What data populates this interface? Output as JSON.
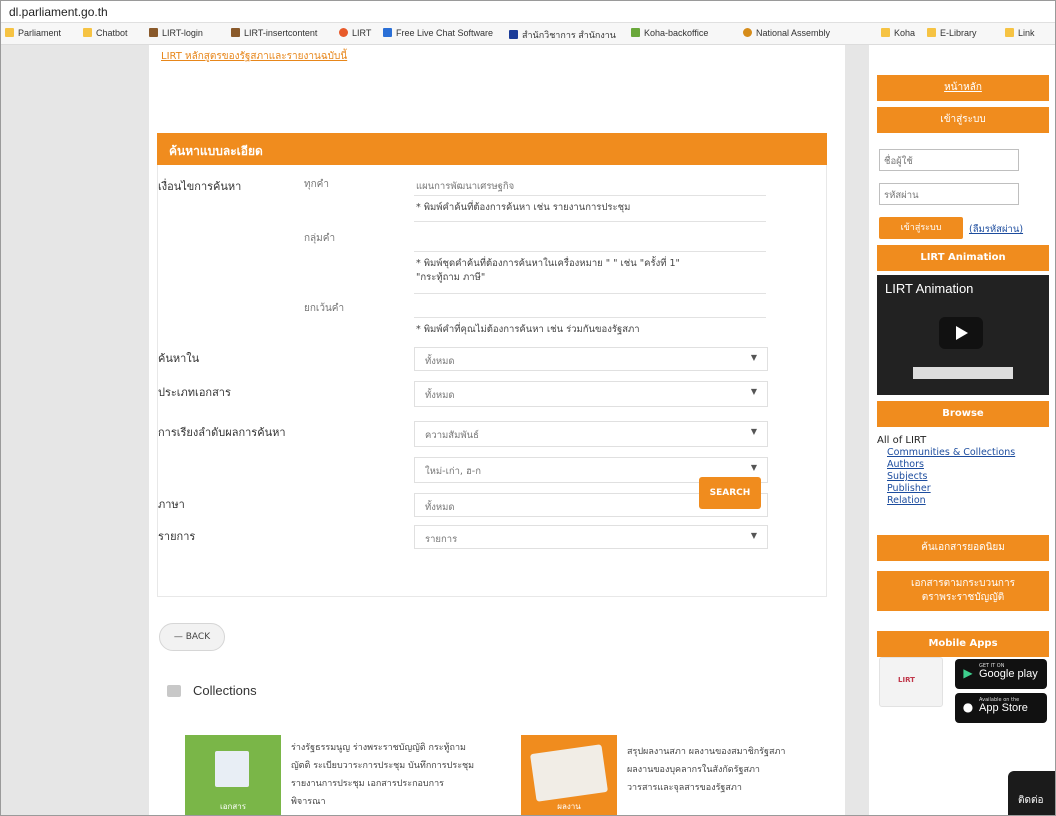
{
  "browser": {
    "address": "dl.parliament.go.th",
    "bookmarks": [
      {
        "label": "Parliament",
        "color": "#f6c343"
      },
      {
        "label": "Chatbot",
        "color": "#f6c343"
      },
      {
        "label": "LIRT-login",
        "color": "#8a5a2b"
      },
      {
        "label": "LIRT-insertcontent",
        "color": "#8a5a2b"
      },
      {
        "label": "LIRT",
        "color": "#e85a2a"
      },
      {
        "label": "Free Live Chat Software",
        "color": "#2a6fd6"
      },
      {
        "label": "สำนักวิชาการ สำนักงาน",
        "color": "#1c3c99"
      },
      {
        "label": "Koha-backoffice",
        "color": "#6aa83b"
      },
      {
        "label": "National Assembly",
        "color": "#d68c1a"
      },
      {
        "label": "Koha",
        "color": "#f6c343"
      },
      {
        "label": "E-Library",
        "color": "#f6c343"
      },
      {
        "label": "Link",
        "color": "#f6c343"
      }
    ]
  },
  "main": {
    "top_link": "LIRT หลักสูตรของรัฐสภาและรายงานฉบับนี้",
    "search_header": "ค้นหาแบบละเอียด",
    "form": {
      "condition_label": "เงื่อนไขการค้นหา",
      "all_words_label": "ทุกคำ",
      "all_words_value": "แผนการพัฒนาเศรษฐกิจ",
      "all_words_hint": "* พิมพ์คำค้นที่ต้องการค้นหา เช่น รายงานการประชุม",
      "phrase_label": "กลุ่มคำ",
      "phrase_hint_1": "* พิมพ์ชุดคำค้นที่ต้องการค้นหาในเครื่องหมาย \" \" เช่น \"ครั้งที่ 1\"",
      "phrase_hint_2": "\"กระทู้ถาม ภาษี\"",
      "exclude_label": "ยกเว้นคำ",
      "exclude_hint": "* พิมพ์คำที่คุณไม่ต้องการค้นหา เช่น ร่วมกันของรัฐสภา",
      "search_in_label": "ค้นหาใน",
      "search_in_value": "ทั้งหมด",
      "doc_type_label": "ประเภทเอกสาร",
      "doc_type_value": "ทั้งหมด",
      "sort_label": "การเรียงลำดับผลการค้นหา",
      "sort_value": "ความสัมพันธ์",
      "order_value": "ใหม่-เก่า, ฮ-ก",
      "language_label": "ภาษา",
      "language_value": "ทั้งหมด",
      "items_label": "รายการ",
      "items_value": "รายการ",
      "arrow": "▼",
      "search_button": "SEARCH"
    },
    "back_button": "— BACK",
    "collections": {
      "title": "Collections",
      "cards": [
        {
          "label": "เอกสาร",
          "lines": [
            "ร่างรัฐธรรมนูญ ร่างพระราชบัญญัติ กระทู้ถาม",
            "ญัตติ ระเบียบวาระการประชุม บันทึกการประชุม",
            "รายงานการประชุม เอกสารประกอบการพิจารณา"
          ]
        },
        {
          "label": "ผลงาน",
          "lines": [
            "สรุปผลงานสภา ผลงานของสมาชิกรัฐสภา",
            "ผลงานของบุคลากรในสังกัดรัฐสภา",
            "วารสารและจุลสารของรัฐสภา"
          ]
        }
      ]
    }
  },
  "sidebar": {
    "top_link": "หน้าหลัก",
    "login_header": "เข้าสู่ระบบ",
    "username_placeholder": "ชื่อผู้ใช้",
    "password_placeholder": "รหัสผ่าน",
    "login_button": "เข้าสู่ระบบ",
    "forgot_link": "(ลืมรหัสผ่าน)",
    "animation_header": "LIRT Animation",
    "video_title": "LIRT Animation",
    "browse_header": "Browse",
    "browse_title": "All of LIRT",
    "browse_links": [
      "Communities & Collections",
      "Authors",
      "Subjects",
      "Publisher",
      "Relation"
    ],
    "popular_header": "ค้นเอกสารยอดนิยม",
    "legislative_header_1": "เอกสารตามกระบวนการ",
    "legislative_header_2": "ตราพระราชบัญญัติ",
    "mobile_header": "Mobile Apps",
    "google_small": "GET IT ON",
    "google_big": "Google play",
    "apple_small": "Available on the",
    "apple_big": "App Store",
    "logo_text": "LIRT",
    "chat_label": "ติดต่อ"
  },
  "colors": {
    "accent": "#f08c1e",
    "link": "#1c4c9e"
  }
}
